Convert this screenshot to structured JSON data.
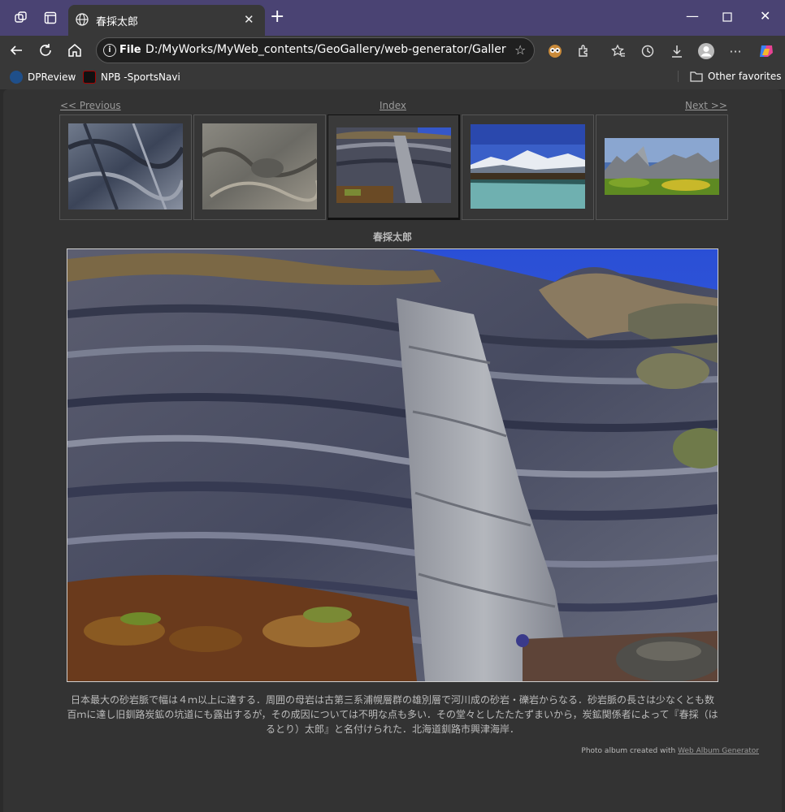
{
  "browser": {
    "tab_title": "春採太郎",
    "address_scheme": "File",
    "address_url": "D:/MyWorks/MyWeb_contents/GeoGallery/web-generator/Gallery_wo...",
    "favorites": [
      "DPReview",
      "NPB -SportsNavi"
    ],
    "other_favorites": "Other favorites"
  },
  "colors": {
    "titlebar": "#4a4373",
    "page_bg": "#333333",
    "link": "#9a9a9a"
  },
  "gallery": {
    "prev_label": "<< Previous",
    "index_label": "Index",
    "next_label": "Next >>",
    "thumbnails": [
      "thumb-rock-folds",
      "thumb-rock-relief",
      "thumb-haru-taro",
      "thumb-mountain-lake",
      "thumb-rock-peaks"
    ],
    "active_thumbnail": 3,
    "photo_title": "春採太郎",
    "description": "日本最大の砂岩脈で幅は４ｍ以上に達する．周囲の母岩は古第三系浦幌層群の雄別層で河川成の砂岩・礫岩からなる．砂岩脈の長さは少なくとも数百ｍに達し旧釧路炭鉱の坑道にも露出するが，その成因については不明な点も多い．その堂々としたたたずまいから，炭鉱関係者によって『春採（はるとり）太郎』と名付けられた．北海道釧路市興津海岸．",
    "credit_prefix": "Photo album created with",
    "credit_link": "Web Album Generator"
  }
}
